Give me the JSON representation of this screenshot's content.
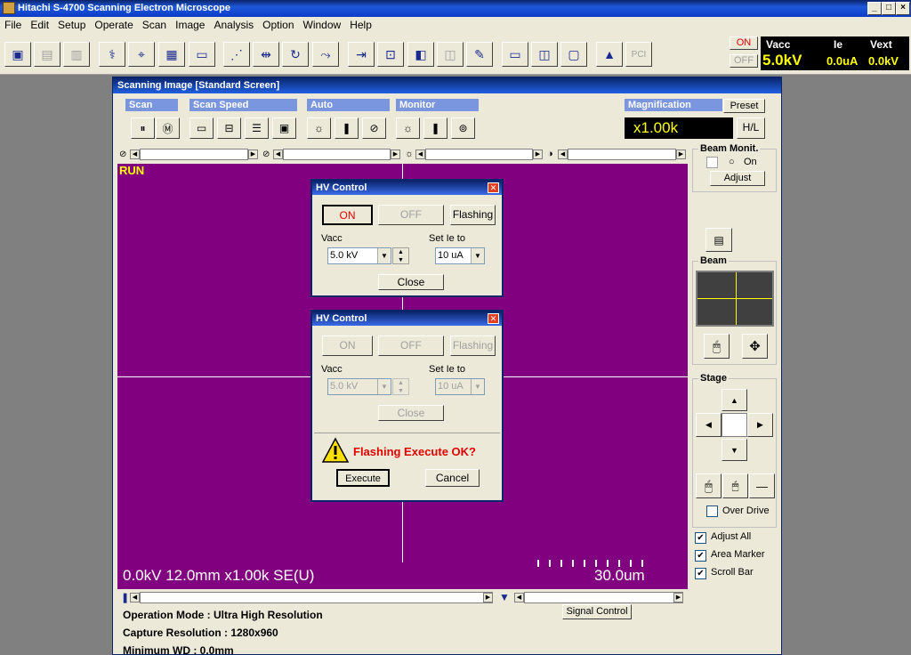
{
  "app": {
    "title": "Hitachi S-4700 Scanning Electron Microscope"
  },
  "window_controls": {
    "minimize": "_",
    "maximize": "□",
    "close": "×"
  },
  "menu": [
    "File",
    "Edit",
    "Setup",
    "Operate",
    "Scan",
    "Image",
    "Analysis",
    "Option",
    "Window",
    "Help"
  ],
  "toolbar": {
    "hv_on": "ON",
    "hv_off": "OFF",
    "pci_label": "PCI"
  },
  "status": {
    "vacc_label": "Vacc",
    "ie_label": "Ie",
    "vext_label": "Vext",
    "vacc_value": "5.0kV",
    "ie_value": "0.0uA",
    "vext_value": "0.0kV"
  },
  "scan_window": {
    "title": "Scanning Image [Standard Screen]",
    "scan_label": "Scan",
    "scan_speed_label": "Scan Speed",
    "auto_label": "Auto",
    "monitor_label": "Monitor",
    "magnification_label": "Magnification",
    "preset_label": "Preset",
    "hl_label": "H/L",
    "magnification": "x1.00k",
    "run_label": "RUN",
    "info_bar": "0.0kV 12.0mm x1.00k SE(U)",
    "scale_bar": "30.0um",
    "signal_control": "Signal Control",
    "operation_mode": "Operation Mode : Ultra High Resolution",
    "capture_resolution": "Capture Resolution : 1280x960",
    "minimum_wd": "Minimum WD : 0.0mm"
  },
  "right_panel": {
    "beam_monitor_label": "Beam Monit.",
    "on_label": "On",
    "adjust_label": "Adjust",
    "beam_label": "Beam",
    "stage_label": "Stage",
    "over_drive": "Over Drive",
    "adjust_all": "Adjust All",
    "area_marker": "Area Marker",
    "scroll_bar": "Scroll Bar",
    "adjust_all_checked": true,
    "area_marker_checked": true,
    "scroll_bar_checked": true
  },
  "hv_dialog_1": {
    "title": "HV Control",
    "on": "ON",
    "off": "OFF",
    "flashing": "Flashing",
    "vacc_label": "Vacc",
    "set_ie_label": "Set Ie to",
    "vacc_value": "5.0 kV",
    "ie_value": "10 uA",
    "close": "Close"
  },
  "hv_dialog_2": {
    "title": "HV Control",
    "on": "ON",
    "off": "OFF",
    "flashing": "Flashing",
    "vacc_label": "Vacc",
    "set_ie_label": "Set Ie to",
    "vacc_value": "5.0 kV",
    "ie_value": "10 uA",
    "close": "Close",
    "confirm_message": "Flashing Execute OK?",
    "execute": "Execute",
    "cancel": "Cancel"
  }
}
